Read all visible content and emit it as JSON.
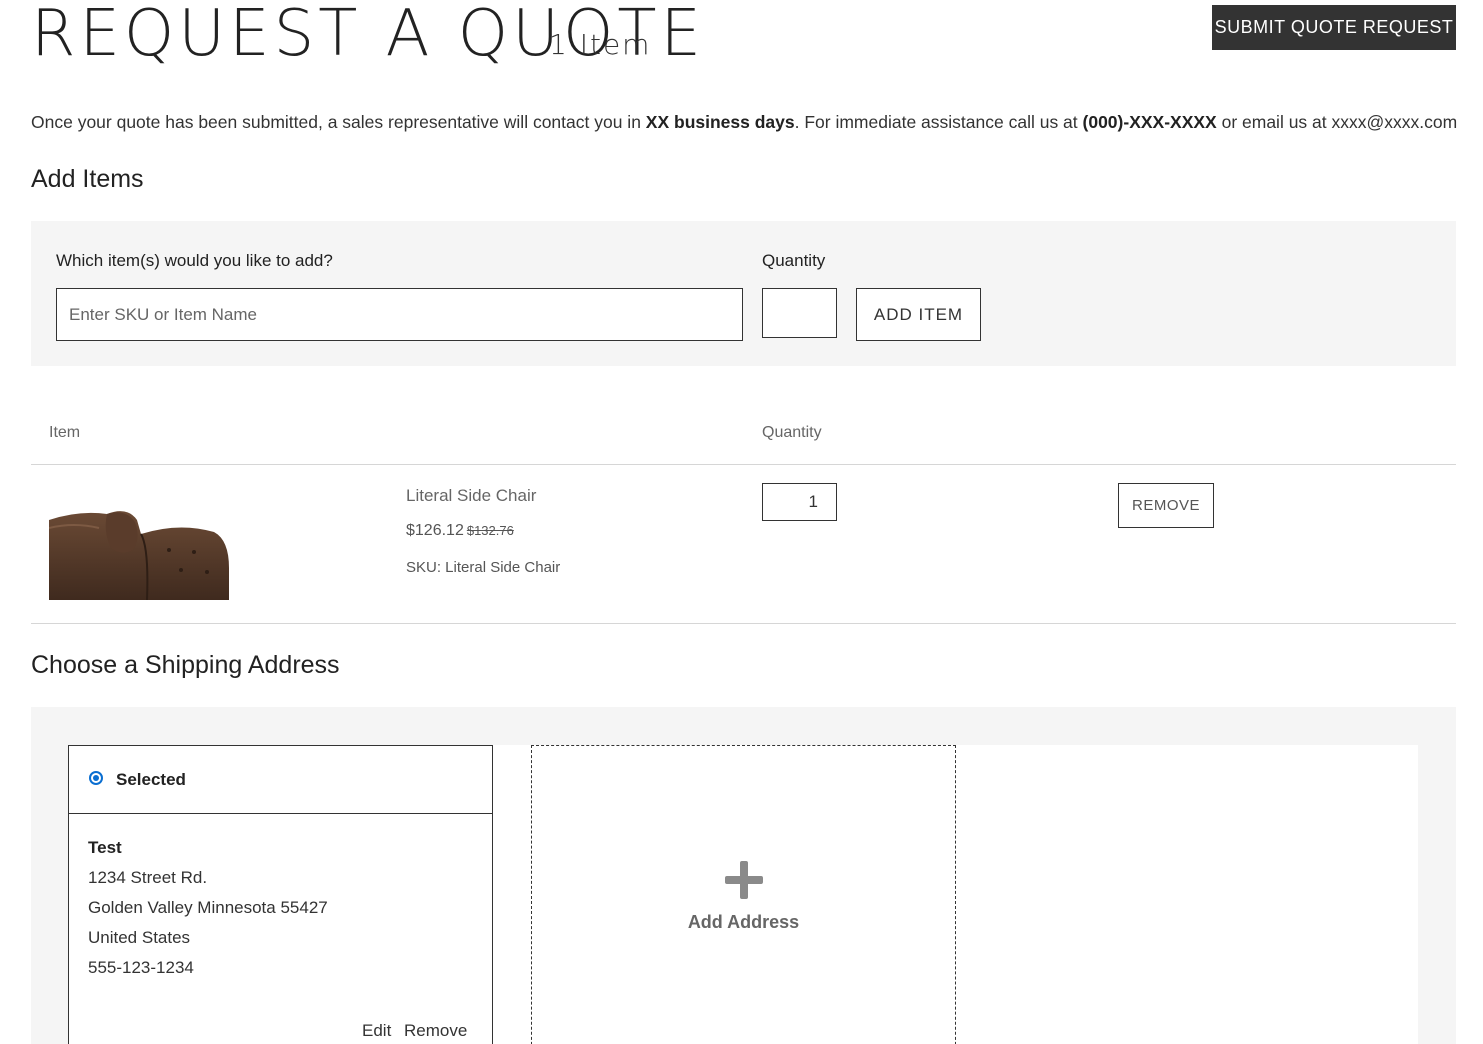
{
  "header": {
    "title": "REQUEST A QUOTE",
    "item_count": "1 Item",
    "submit_label": "SUBMIT QUOTE REQUEST"
  },
  "intro": {
    "part1": "Once your quote has been submitted, a sales representative will contact you in ",
    "days": "XX business days",
    "part2": ". For immediate assistance call us at ",
    "phone": "(000)-XXX-XXXX",
    "part3": " or email us at xxxx@xxxx.com"
  },
  "add_items": {
    "title": "Add Items",
    "item_label": "Which item(s) would you like to add?",
    "item_placeholder": "Enter SKU or Item Name",
    "qty_label": "Quantity",
    "add_button": "ADD ITEM"
  },
  "table": {
    "headers": [
      "Item",
      "Quantity"
    ],
    "rows": [
      {
        "name": "Literal Side Chair",
        "price": "$126.12",
        "original_price": "$132.76",
        "sku": "SKU: Literal Side Chair",
        "quantity": "1",
        "remove_label": "REMOVE"
      }
    ]
  },
  "shipping": {
    "title": "Choose a Shipping Address",
    "addresses": [
      {
        "status": "Selected",
        "name": "Test",
        "street": "1234 Street Rd.",
        "city_line": "Golden Valley Minnesota 55427",
        "country": "United States",
        "phone": "555-123-1234",
        "edit_label": "Edit",
        "remove_label": "Remove"
      }
    ],
    "add_address_label": "Add Address"
  },
  "colors": {
    "primary_button": "#333333",
    "panel_bg": "#f5f5f5",
    "radio_accent": "#0a6ed1"
  }
}
